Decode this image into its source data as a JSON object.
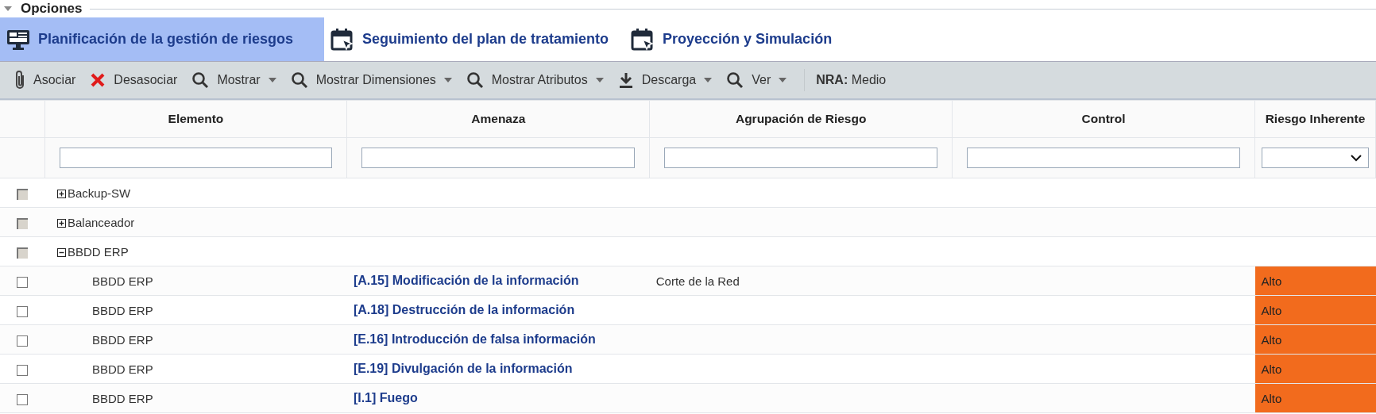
{
  "section": {
    "title": "Opciones",
    "expanded": true
  },
  "tabs": [
    {
      "label": "Planificación de la gestión de riesgos",
      "kind": "monitor",
      "selected": true
    },
    {
      "label": "Seguimiento del plan de tratamiento",
      "kind": "calendar",
      "selected": false
    },
    {
      "label": "Proyección y Simulación",
      "kind": "calendar",
      "selected": false
    }
  ],
  "toolbar": [
    {
      "label": "Asociar",
      "kind": "attach",
      "dropdown": false
    },
    {
      "label": "Desasociar",
      "kind": "remove",
      "dropdown": false
    },
    {
      "label": "Mostrar",
      "kind": "search",
      "dropdown": true
    },
    {
      "label": "Mostrar Dimensiones",
      "kind": "search",
      "dropdown": true
    },
    {
      "label": "Mostrar Atributos",
      "kind": "search",
      "dropdown": true
    },
    {
      "label": "Descarga",
      "kind": "download",
      "dropdown": true
    },
    {
      "label": "Ver",
      "kind": "search",
      "dropdown": true
    }
  ],
  "nra": {
    "label": "NRA:",
    "value": "Medio"
  },
  "table": {
    "columns": [
      {
        "label": "Elemento",
        "kind": "text"
      },
      {
        "label": "Amenaza",
        "kind": "text"
      },
      {
        "label": "Agrupación de Riesgo",
        "kind": "text"
      },
      {
        "label": "Control",
        "kind": "text"
      },
      {
        "label": "Riesgo Inherente",
        "kind": "select"
      }
    ],
    "groups": [
      {
        "name": "Backup-SW",
        "expanded": false,
        "checked": false
      },
      {
        "name": "Balanceador",
        "expanded": false,
        "checked": false
      },
      {
        "name": "BBDD ERP",
        "expanded": true,
        "checked": false,
        "rows": [
          {
            "element": "BBDD ERP",
            "threat": "[A.15] Modificación de la información",
            "grouping": "Corte de la Red",
            "risk": "Alto",
            "color": "#f26b1d",
            "checked": false
          },
          {
            "element": "BBDD ERP",
            "threat": "[A.18] Destrucción de la información",
            "risk": "Alto",
            "color": "#f26b1d",
            "checked": false
          },
          {
            "element": "BBDD ERP",
            "threat": "[E.16] Introducción de falsa información",
            "risk": "Alto",
            "color": "#f26b1d",
            "checked": false
          },
          {
            "element": "BBDD ERP",
            "threat": "[E.19] Divulgación de la información",
            "risk": "Alto",
            "color": "#f26b1d",
            "checked": false
          },
          {
            "element": "BBDD ERP",
            "threat": "[I.1] Fuego",
            "risk": "Alto",
            "color": "#f26b1d",
            "checked": false
          }
        ]
      }
    ]
  }
}
